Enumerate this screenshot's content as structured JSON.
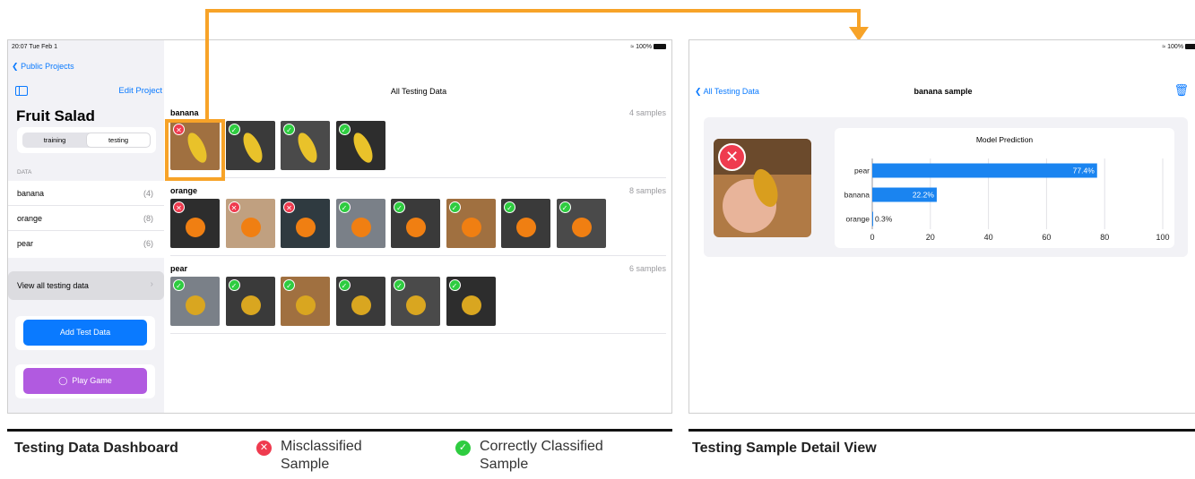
{
  "left_ipad": {
    "status_time": "20:07  Tue Feb 1",
    "status_battery": "100%",
    "sidebar": {
      "back_label": "Public Projects",
      "edit_label": "Edit Project",
      "project_title": "Fruit Salad",
      "segments": [
        "training",
        "testing"
      ],
      "active_segment": "testing",
      "data_header": "DATA",
      "items": [
        {
          "label": "banana",
          "count": "(4)"
        },
        {
          "label": "orange",
          "count": "(8)"
        },
        {
          "label": "pear",
          "count": "(6)"
        }
      ],
      "view_all_label": "View all testing data",
      "add_test_label": "Add Test Data",
      "play_game_label": "Play Game"
    },
    "main": {
      "title": "All Testing Data",
      "groups": [
        {
          "label": "banana",
          "count": "4 samples",
          "results": [
            "bad",
            "good",
            "good",
            "good"
          ]
        },
        {
          "label": "orange",
          "count": "8 samples",
          "results": [
            "bad",
            "bad",
            "bad",
            "good",
            "good",
            "good",
            "good",
            "good"
          ]
        },
        {
          "label": "pear",
          "count": "6 samples",
          "results": [
            "good",
            "good",
            "good",
            "good",
            "good",
            "good"
          ]
        }
      ]
    }
  },
  "right_ipad": {
    "status_battery": "100%",
    "back_label": "All Testing Data",
    "title": "banana sample",
    "chart_title": "Model Prediction"
  },
  "chart_data": {
    "type": "bar",
    "orientation": "horizontal",
    "title": "Model Prediction",
    "categories": [
      "pear",
      "banana",
      "orange"
    ],
    "values": [
      77.4,
      22.2,
      0.3
    ],
    "value_labels": [
      "77.4%",
      "22.2%",
      "0.3%"
    ],
    "xlim": [
      0,
      100
    ],
    "xticks": [
      0,
      20,
      40,
      60,
      80,
      100
    ],
    "grid": true,
    "bar_color": "#1a84f0"
  },
  "captions": {
    "left": "Testing Data Dashboard",
    "legend_bad": "Misclassified Sample",
    "legend_good": "Correctly Classified Sample",
    "right": "Testing Sample Detail View"
  },
  "colors": {
    "accent": "#0a7aff",
    "highlight": "#f7a328",
    "misclassified": "#ef3b4f",
    "correct": "#2ecc40",
    "add_button": "#0a7aff",
    "game_button": "#b15ae0"
  },
  "icons": {
    "bad": "x-circle-icon",
    "good": "check-circle-icon"
  }
}
